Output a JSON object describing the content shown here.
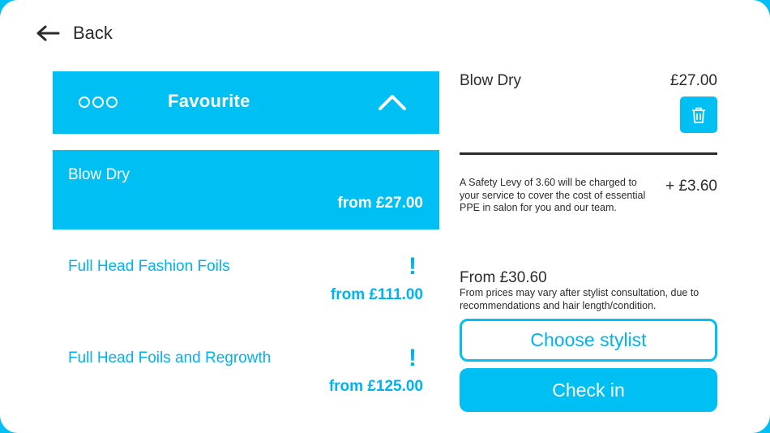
{
  "back": {
    "label": "Back"
  },
  "favourites": {
    "title": "Favourite",
    "items": [
      {
        "name": "Blow Dry",
        "price": "from £27.00",
        "selected": true
      },
      {
        "name": "Full Head Fashion Foils",
        "price": "from £111.00",
        "alert": "!"
      },
      {
        "name": "Full Head Foils and Regrowth",
        "price": "from £125.00",
        "alert": "!"
      }
    ]
  },
  "basket": {
    "service_name": "Blow Dry",
    "service_price": "£27.00",
    "levy_text": "A Safety Levy of 3.60 will be charged to your service to cover the cost of essential PPE in salon for you and our team.",
    "levy_price": "+ £3.60",
    "total": "From £30.60",
    "note": "From prices may vary after stylist consultation, due to recommendations and hair length/condition.",
    "choose_stylist_label": "Choose stylist",
    "check_in_label": "Check in"
  },
  "colors": {
    "accent": "#00c0f3",
    "text": "#2b2b2b",
    "link": "#00b2ee"
  },
  "icons": [
    "back-arrow-icon",
    "more-dots-icon",
    "chevron-up-icon",
    "trash-icon",
    "alert-icon"
  ]
}
